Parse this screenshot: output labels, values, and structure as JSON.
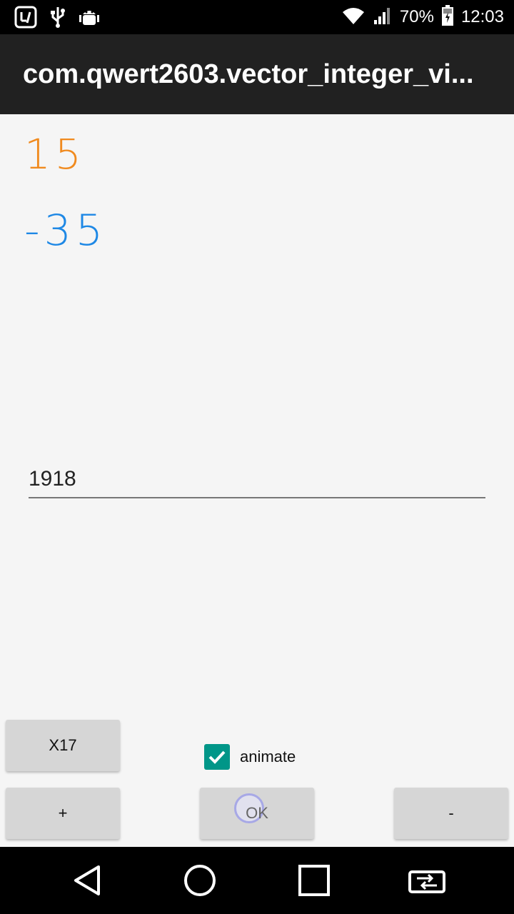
{
  "status_bar": {
    "battery": "70%",
    "time": "12:03",
    "icons": [
      "app-notification-icon",
      "usb-icon",
      "android-debug-icon",
      "wifi-icon",
      "signal-icon",
      "battery-icon"
    ]
  },
  "app_bar": {
    "title": "com.qwert2603.vector_integer_vi..."
  },
  "main": {
    "value_orange": "15",
    "value_blue": "-35",
    "input_value": "1918"
  },
  "controls": {
    "x17_label": "X17",
    "animate_label": "animate",
    "animate_checked": true,
    "plus_label": "+",
    "ok_label": "OK",
    "minus_label": "-"
  },
  "nav_bar": {
    "icons": [
      "back-icon",
      "home-icon",
      "recents-icon",
      "switch-app-icon"
    ]
  },
  "colors": {
    "orange": "#f08a1e",
    "blue": "#1e88e5",
    "accent": "#009688"
  }
}
